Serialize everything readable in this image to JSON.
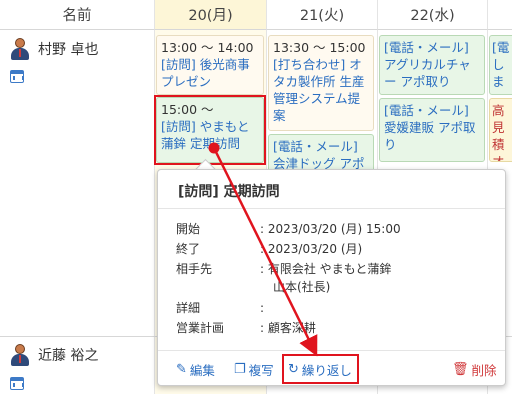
{
  "header": {
    "name_col": "名前",
    "days": [
      "20(月)",
      "21(火)",
      "22(水)"
    ]
  },
  "people": [
    {
      "name": "村野 卓也"
    },
    {
      "name": "近藤 裕之"
    }
  ],
  "events": {
    "e1": {
      "time": "13:00 ～ 14:00",
      "text": "[訪問] 後光商事プレゼン"
    },
    "e2": {
      "time": "15:00 ～",
      "text": "[訪問] やまもと蒲鉾 定期訪問"
    },
    "e3": {
      "time": "13:30 ～ 15:00",
      "text": "[打ち合わせ] オタカ製作所 生産管理システム提案"
    },
    "e4": {
      "text": "[電話・メール] 会津ドッグ アポ"
    },
    "e5": {
      "text": "[電話・メール] アグリカルチャー アポ取り"
    },
    "e6": {
      "text": "[電話・メール] 愛媛建販 アポ取り"
    },
    "e7": {
      "text": "[電しま"
    },
    "e8": {
      "text": "高 見積オロ"
    }
  },
  "popup": {
    "title": "[訪問] 定期訪問",
    "fields": [
      {
        "label": "開始",
        "value": ": 2023/03/20 (月) 15:00"
      },
      {
        "label": "終了",
        "value": ": 2023/03/20 (月)"
      },
      {
        "label": "相手先",
        "value": ": 有限会社 やまもと蒲鉾"
      },
      {
        "label": "",
        "value": "山本(社長)"
      },
      {
        "label": "詳細",
        "value": ":"
      },
      {
        "label": "営業計画",
        "value": ": 顧客深耕"
      }
    ],
    "actions": {
      "edit": "編集",
      "copy": "複写",
      "repeat": "繰り返し",
      "delete": "削除"
    }
  },
  "colors": {
    "accent_red": "#e0141e",
    "link_blue": "#2a6dc0",
    "today_bg": "#fdf6d7"
  }
}
